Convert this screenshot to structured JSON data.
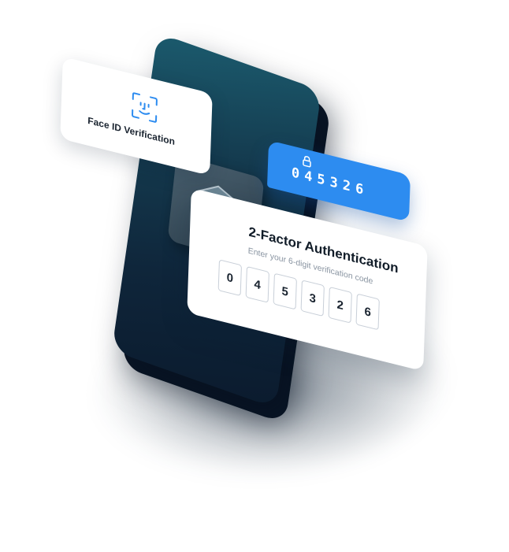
{
  "face_id_card": {
    "label": "Face ID Verification",
    "icon": "face-id-icon"
  },
  "code_chip": {
    "icon": "lock-icon",
    "code": "045326"
  },
  "twofa_card": {
    "title": "2-Factor Authentication",
    "subtitle": "Enter your 6-digit verification code",
    "digits": [
      "0",
      "4",
      "5",
      "3",
      "2",
      "6"
    ]
  },
  "phone": {
    "logo_icon": "shield-logo-icon"
  },
  "colors": {
    "accent_blue": "#2d8cf0",
    "phone_dark": "#0f263b",
    "phone_teal": "#1b5a6d"
  }
}
